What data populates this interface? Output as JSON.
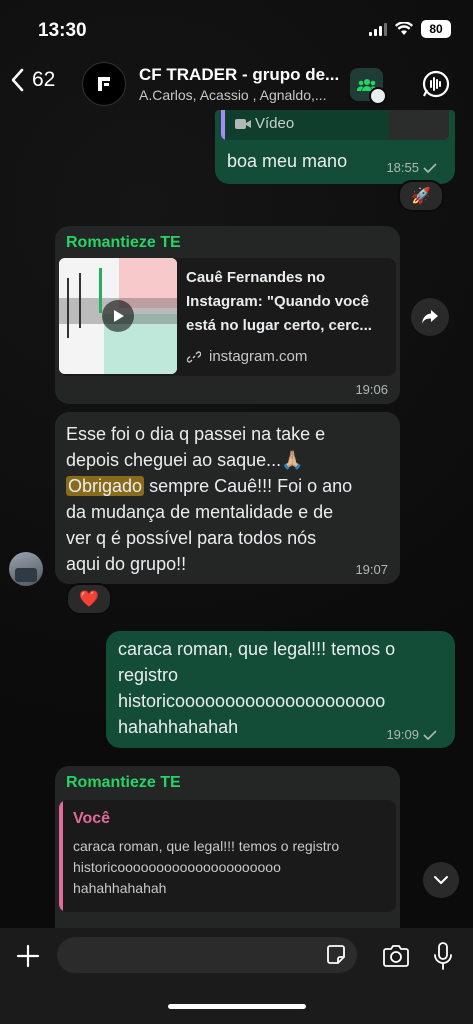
{
  "status": {
    "time": "13:30",
    "battery": "80"
  },
  "header": {
    "back_count": "62",
    "title": "CF TRADER - grupo de...",
    "members": "A.Carlos, Acassio , Agnaldo,..."
  },
  "messages": {
    "m1": {
      "video_label": "Vídeo",
      "text": "boa meu mano",
      "time": "18:55",
      "reaction": "🚀"
    },
    "m2": {
      "sender": "Romantieze TE",
      "link_title_1": "Cauê Fernandes no",
      "link_title_2": "Instagram: \"Quando você",
      "link_title_3": "está no lugar certo, cerc...",
      "link_domain": "instagram.com",
      "time": "19:06"
    },
    "m3": {
      "line1": "Esse foi o dia q passei na take e",
      "line2_a": "depois cheguei ao saque...",
      "line2_emoji": "🙏🏼",
      "line3_highlight": "Obrigado",
      "line3_rest": " sempre Cauê!!! Foi o ano",
      "line4": "da mudança de mentalidade e de",
      "line5": "ver q é possível para todos nós",
      "line6": "aqui do grupo!!",
      "time": "19:07",
      "reaction": "❤️"
    },
    "m4": {
      "line1": "caraca roman, que legal!!! temos o",
      "line2": "registro",
      "line3": "historicooooooooooooooooooooo",
      "line4": "hahahhahahah",
      "time": "19:09"
    },
    "m5": {
      "sender": "Romantieze TE",
      "quote_author": "Você",
      "quote_line1": "caraca roman, que legal!!! temos o registro",
      "quote_line2": "historicooooooooooooooooooooo",
      "quote_line3": "hahahhahahah"
    }
  },
  "colors": {
    "accent_green": "#25d366",
    "outgoing_bubble": "#134d37",
    "incoming_bubble": "#242626",
    "quote_pink": "#e26b9b"
  }
}
